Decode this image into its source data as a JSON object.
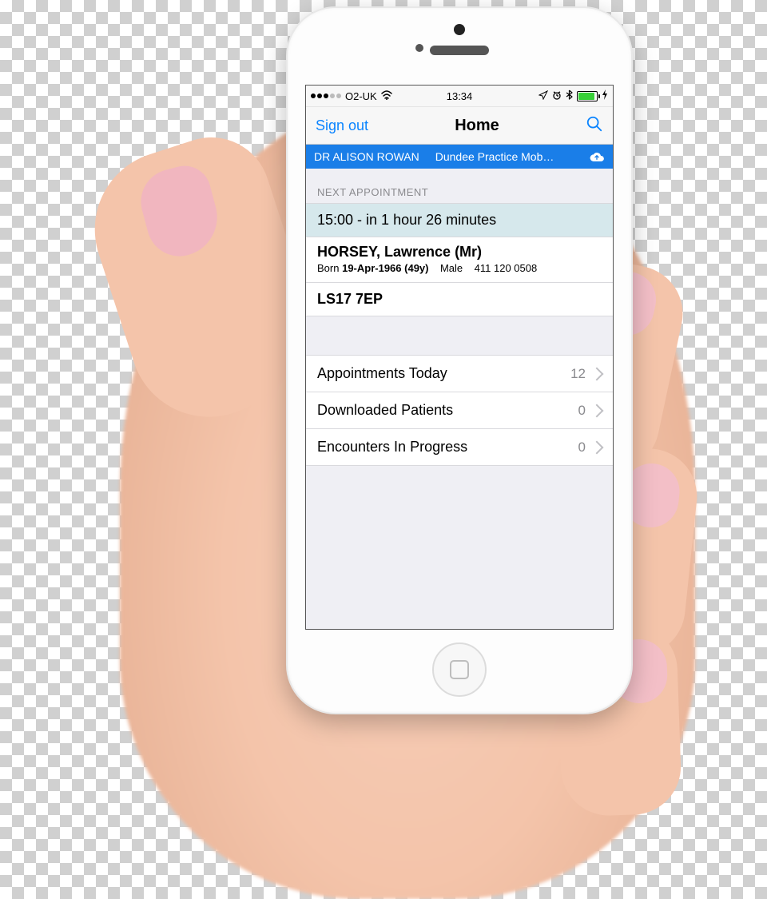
{
  "status": {
    "carrier": "O2-UK",
    "time": "13:34",
    "wifi_glyph": "⋮",
    "nav_glyph": "➤",
    "alarm_glyph": "⏰",
    "bt_glyph": "✽",
    "charge_glyph": "⚡"
  },
  "nav": {
    "left": "Sign out",
    "title": "Home"
  },
  "identity": {
    "doctor": "DR ALISON ROWAN",
    "practice": "Dundee Practice Mob…"
  },
  "next_appt": {
    "header": "NEXT APPOINTMENT",
    "time_line": "15:00 - in 1 hour 26 minutes",
    "patient_name": "HORSEY, Lawrence (Mr)",
    "born_label": "Born",
    "born_value": "19-Apr-1966 (49y)",
    "sex": "Male",
    "phone": "411 120 0508",
    "postcode": "LS17 7EP"
  },
  "rows": [
    {
      "label": "Appointments Today",
      "count": "12"
    },
    {
      "label": "Downloaded Patients",
      "count": "0"
    },
    {
      "label": "Encounters In Progress",
      "count": "0"
    }
  ]
}
